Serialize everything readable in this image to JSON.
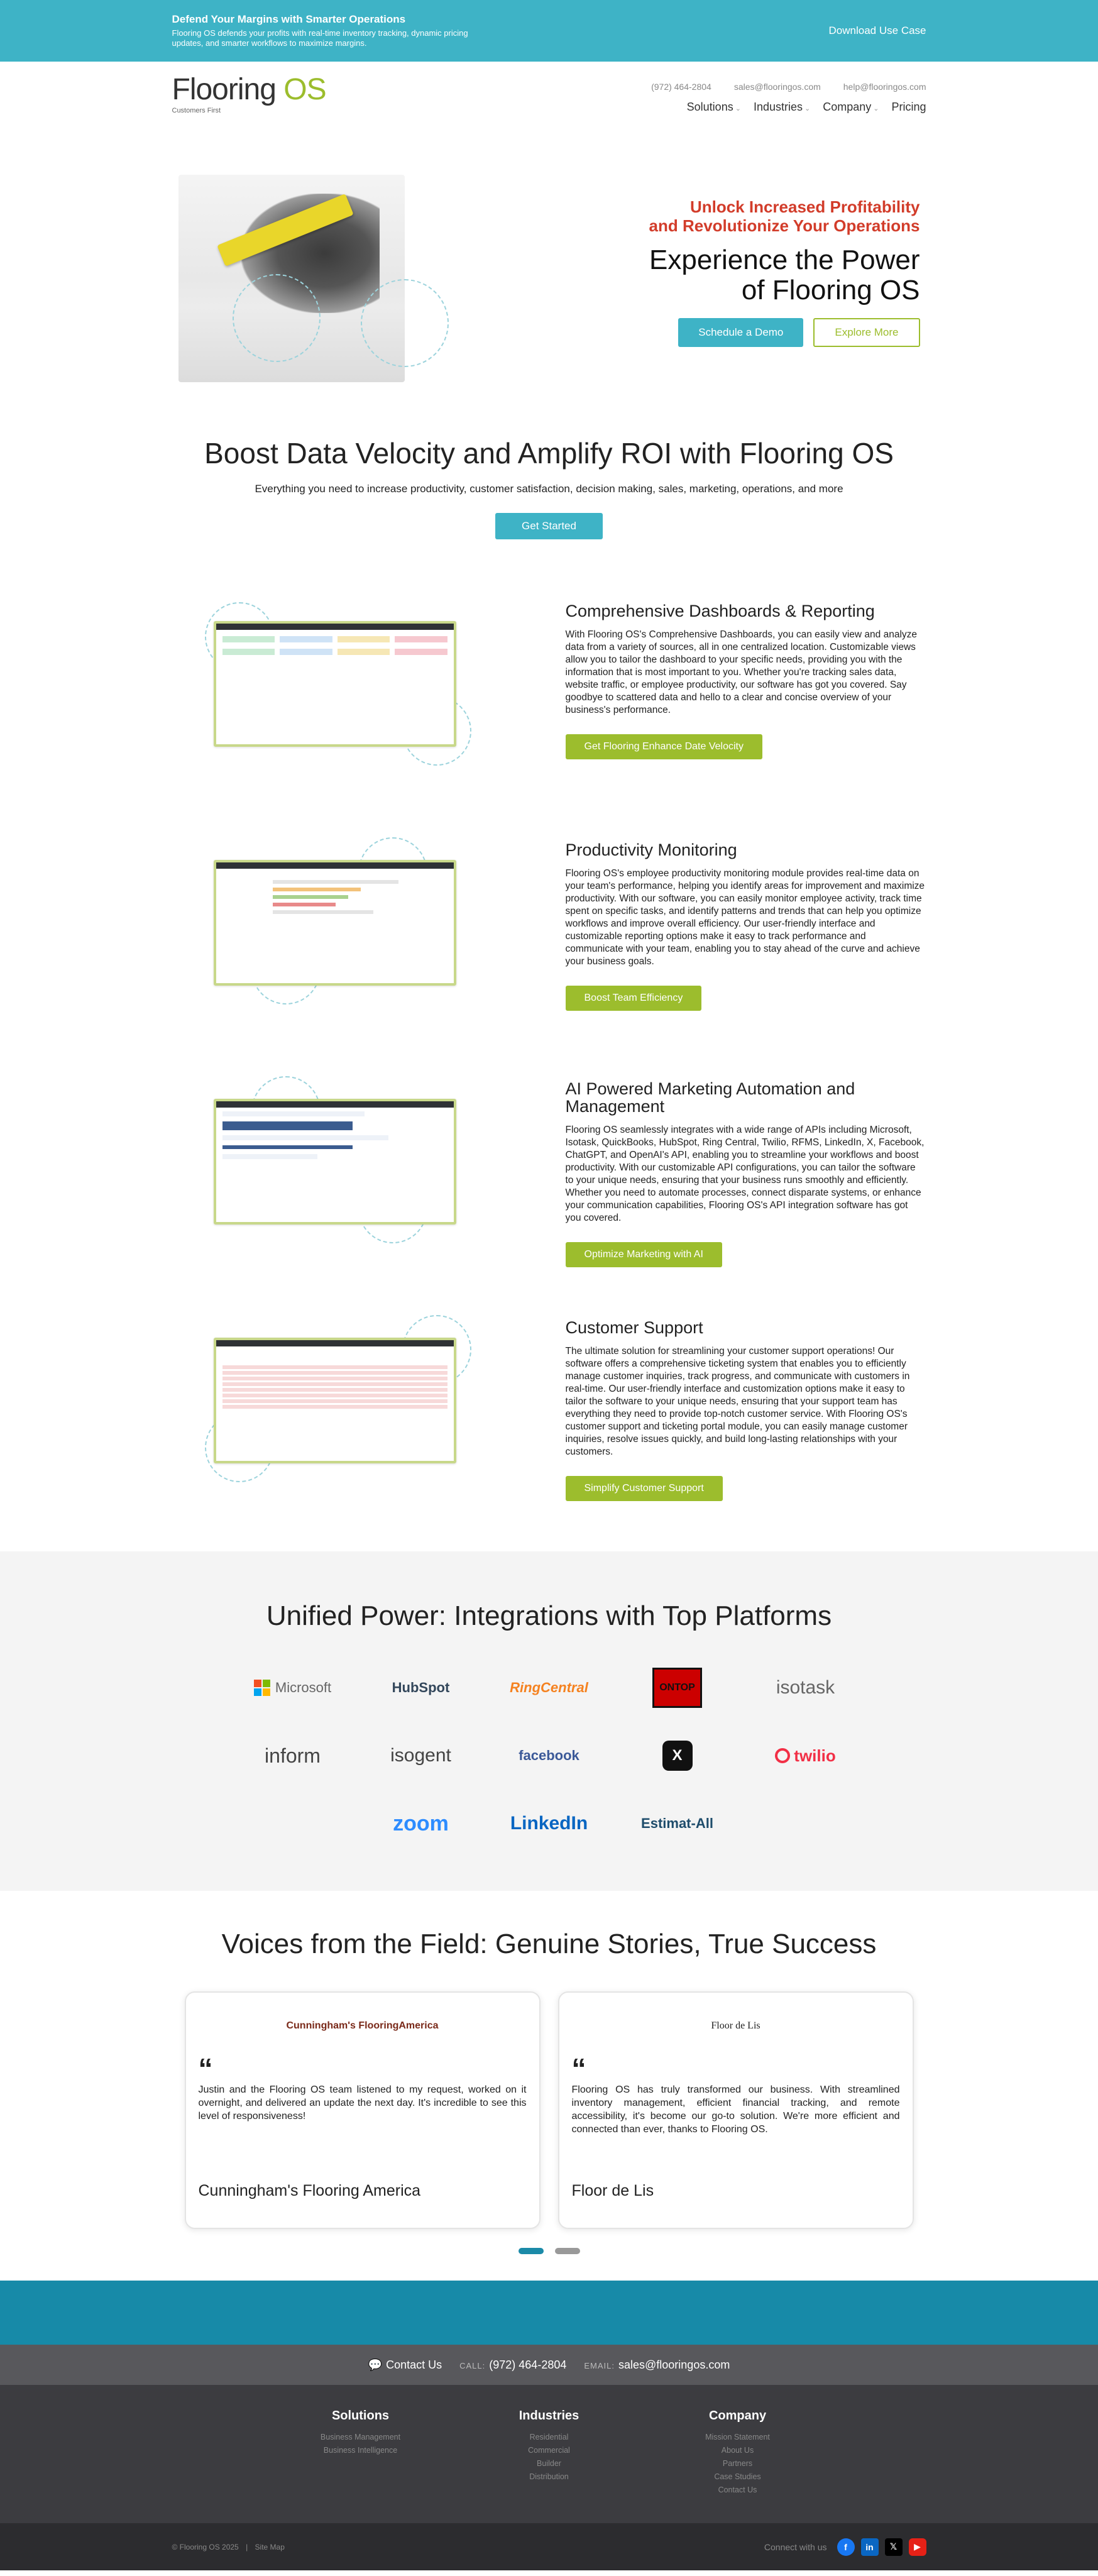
{
  "topbar": {
    "headline": "Defend Your Margins with Smarter Operations",
    "text": "Flooring OS defends your profits with real-time inventory tracking, dynamic pricing updates, and smarter workflows to maximize margins.",
    "cta": "Download Use Case"
  },
  "header": {
    "logo_main": "Flooring ",
    "logo_accent": "OS",
    "tagline": "Customers First",
    "phone": "(972) 464-2804",
    "sales_email": "sales@flooringos.com",
    "help_email": "help@flooringos.com",
    "nav": [
      "Solutions",
      "Industries",
      "Company",
      "Pricing"
    ]
  },
  "hero": {
    "subtitle_1": "Unlock Increased Profitability",
    "subtitle_2": "and Revolutionize Your Operations",
    "title_1": "Experience the Power",
    "title_2": "of Flooring OS",
    "demo_button": "Schedule a Demo",
    "explore_button": "Explore More"
  },
  "boost": {
    "title": "Boost Data Velocity and Amplify ROI with Flooring OS",
    "text": "Everything you need to increase productivity, customer satisfaction, decision making, sales, marketing, operations, and more",
    "button": "Get Started"
  },
  "features": [
    {
      "title": "Comprehensive Dashboards & Reporting",
      "text": "With Flooring OS's Comprehensive Dashboards, you can easily view and analyze data from a variety of sources, all in one centralized location. Customizable views allow you to tailor the dashboard to your specific needs, providing you with the information that is most important to you. Whether you're tracking sales data, website traffic, or employee productivity, our software has got you covered. Say goodbye to scattered data and hello to a clear and concise overview of your business's performance.",
      "button": "Get Flooring Enhance Date Velocity"
    },
    {
      "title": "Productivity Monitoring",
      "text": "Flooring OS's employee productivity monitoring module provides real-time data on your team's performance, helping you identify areas for improvement and maximize productivity. With our software, you can easily monitor employee activity, track time spent on specific tasks, and identify patterns and trends that can help you optimize workflows and improve overall efficiency. Our user-friendly interface and customizable reporting options make it easy to track performance and communicate with your team, enabling you to stay ahead of the curve and achieve your business goals.",
      "button": "Boost Team Efficiency"
    },
    {
      "title": "AI Powered Marketing Automation and Management",
      "text": "Flooring OS seamlessly integrates with a wide range of APIs including Microsoft, Isotask, QuickBooks, HubSpot, Ring Central, Twilio, RFMS, LinkedIn, X, Facebook, ChatGPT, and OpenAI's API, enabling you to streamline your workflows and boost productivity. With our customizable API configurations, you can tailor the software to your unique needs, ensuring that your business runs smoothly and efficiently. Whether you need to automate processes, connect disparate systems, or enhance your communication capabilities, Flooring OS's API integration software has got you covered.",
      "button": "Optimize Marketing with AI"
    },
    {
      "title": "Customer Support",
      "text": "The ultimate solution for streamlining your customer support operations! Our software offers a comprehensive ticketing system that enables you to efficiently manage customer inquiries, track progress, and communicate with customers in real-time. Our user-friendly interface and customization options make it easy to tailor the software to your unique needs, ensuring that your support team has everything they need to provide top-notch customer service. With Flooring OS's customer support and ticketing portal module, you can easily manage customer inquiries, resolve issues quickly, and build long-lasting relationships with your customers.",
      "button": "Simplify Customer Support"
    }
  ],
  "integrations": {
    "title": "Unified Power: Integrations with Top Platforms",
    "logos": [
      "Microsoft",
      "HubSpot",
      "RingCentral",
      "ONTOP",
      "isotask",
      "inform",
      "isogent",
      "facebook",
      "X",
      "twilio",
      "zoom",
      "LinkedIn",
      "Estimat-All"
    ]
  },
  "voices": {
    "title": "Voices from the Field: Genuine Stories, True Success",
    "cards": [
      {
        "logo": "Cunningham's FlooringAmerica",
        "quote": "Justin and the Flooring OS team listened to my request, worked on it overnight, and delivered an update the next day. It's incredible to see this level of responsiveness!",
        "name": "Cunningham's Flooring America"
      },
      {
        "logo": "Floor de Lis",
        "quote": "Flooring OS has truly transformed our business. With streamlined inventory management, efficient financial tracking, and remote accessibility, it's become our go-to solution. We're more efficient and connected than ever, thanks to Flooring OS.",
        "name": "Floor de Lis"
      }
    ]
  },
  "contact_bar": {
    "contact_us": "Contact Us",
    "call_label": "CALL:",
    "phone": "(972) 464-2804",
    "email_label": "EMAIL:",
    "email": "sales@flooringos.com"
  },
  "footer": {
    "solutions_title": "Solutions",
    "solutions": [
      "Business Management",
      "Business Intelligence"
    ],
    "industries_title": "Industries",
    "industries": [
      "Residential",
      "Commercial",
      "Builder",
      "Distribution"
    ],
    "company_title": "Company",
    "company": [
      "Mission Statement",
      "About Us",
      "Partners",
      "Case Studies",
      "Contact Us"
    ],
    "copyright": "© Flooring OS 2025",
    "sitemap": "Site Map",
    "connect": "Connect with us"
  },
  "colors": {
    "teal": "#3eb3c6",
    "green": "#9cbd2d",
    "red": "#d23c2a",
    "dark_teal": "#178aa8"
  }
}
